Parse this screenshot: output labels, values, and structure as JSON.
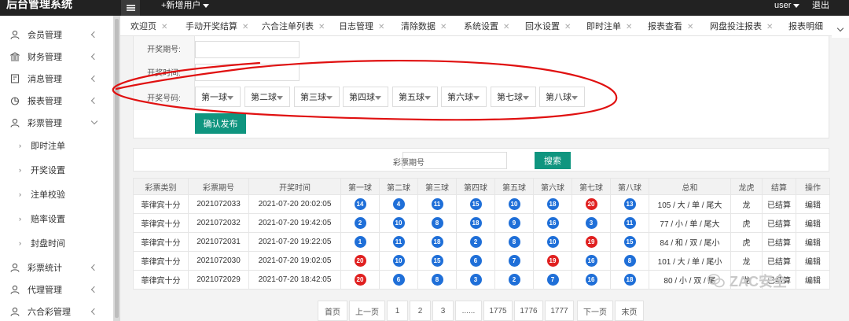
{
  "topbar": {
    "brand": "后台管理系统",
    "new_user": "+新增用户",
    "user": "user",
    "logout": "退出"
  },
  "sidebar": {
    "items": [
      {
        "label": "会员管理",
        "icon": "user-icon"
      },
      {
        "label": "财务管理",
        "icon": "bank-icon"
      },
      {
        "label": "消息管理",
        "icon": "document-icon"
      },
      {
        "label": "报表管理",
        "icon": "chart-icon"
      },
      {
        "label": "彩票管理",
        "icon": "user-icon"
      },
      {
        "label": "彩票统计",
        "icon": "user-icon"
      },
      {
        "label": "代理管理",
        "icon": "user-icon"
      },
      {
        "label": "六合彩管理",
        "icon": "user-icon"
      }
    ],
    "sub_items": [
      "即时注单",
      "开奖设置",
      "注单校验",
      "赔率设置",
      "封盘时间"
    ]
  },
  "tabs": [
    "欢迎页",
    "手动开奖结算",
    "六合注单列表",
    "日志管理",
    "清除数据",
    "系统设置",
    "回水设置",
    "即时注单",
    "报表查看",
    "网盘投注报表",
    "报表明细"
  ],
  "form": {
    "period_label": "开奖期号:",
    "time_label": "开奖时间:",
    "numbers_label": "开奖号码:",
    "balls": [
      "第一球",
      "第二球",
      "第三球",
      "第四球",
      "第五球",
      "第六球",
      "第七球",
      "第八球"
    ],
    "publish_button": "确认发布"
  },
  "search": {
    "label": "彩票期号",
    "button": "搜索"
  },
  "table": {
    "headers": [
      "彩票类别",
      "彩票期号",
      "开奖时间",
      "第一球",
      "第二球",
      "第三球",
      "第四球",
      "第五球",
      "第六球",
      "第七球",
      "第八球",
      "总和",
      "龙虎",
      "结算",
      "操作"
    ],
    "rows": [
      {
        "type": "菲律宾十分",
        "period": "2021072033",
        "time": "2021-07-20 20:02:05",
        "balls": [
          "14",
          "4",
          "11",
          "15",
          "10",
          "18",
          "20",
          "13"
        ],
        "colors": [
          "blue",
          "blue",
          "blue",
          "blue",
          "blue",
          "blue",
          "red",
          "blue"
        ],
        "sum": "105 / 大 / 单 / 尾大",
        "dragon": "龙",
        "status": "已结算",
        "action": "编辑"
      },
      {
        "type": "菲律宾十分",
        "period": "2021072032",
        "time": "2021-07-20 19:42:05",
        "balls": [
          "2",
          "10",
          "8",
          "18",
          "9",
          "16",
          "3",
          "11"
        ],
        "colors": [
          "blue",
          "blue",
          "blue",
          "blue",
          "blue",
          "blue",
          "blue",
          "blue"
        ],
        "sum": "77 / 小 / 单 / 尾大",
        "dragon": "虎",
        "status": "已结算",
        "action": "编辑"
      },
      {
        "type": "菲律宾十分",
        "period": "2021072031",
        "time": "2021-07-20 19:22:05",
        "balls": [
          "1",
          "11",
          "18",
          "2",
          "8",
          "10",
          "19",
          "15"
        ],
        "colors": [
          "blue",
          "blue",
          "blue",
          "blue",
          "blue",
          "blue",
          "red",
          "blue"
        ],
        "sum": "84 / 和 / 双 / 尾小",
        "dragon": "虎",
        "status": "已结算",
        "action": "编辑"
      },
      {
        "type": "菲律宾十分",
        "period": "2021072030",
        "time": "2021-07-20 19:02:05",
        "balls": [
          "20",
          "10",
          "15",
          "6",
          "7",
          "19",
          "16",
          "8"
        ],
        "colors": [
          "red",
          "blue",
          "blue",
          "blue",
          "blue",
          "red",
          "blue",
          "blue"
        ],
        "sum": "101 / 大 / 单 / 尾小",
        "dragon": "龙",
        "status": "已结算",
        "action": "编辑"
      },
      {
        "type": "菲律宾十分",
        "period": "2021072029",
        "time": "2021-07-20 18:42:05",
        "balls": [
          "20",
          "6",
          "8",
          "3",
          "2",
          "7",
          "16",
          "18"
        ],
        "colors": [
          "red",
          "blue",
          "blue",
          "blue",
          "blue",
          "blue",
          "blue",
          "blue"
        ],
        "sum": "80 / 小 / 双 / 尾",
        "dragon": "龙",
        "status": "已结算",
        "action": "编辑"
      }
    ]
  },
  "pagination": [
    "首页",
    "上一页",
    "1",
    "2",
    "3",
    "......",
    "1775",
    "1776",
    "1777",
    "下一页",
    "末页"
  ],
  "watermark": "ZAC安全",
  "colors": {
    "accent": "#0f957f",
    "ball_blue": "#1f6fd8",
    "ball_red": "#e02020",
    "annotation": "#e01010"
  }
}
